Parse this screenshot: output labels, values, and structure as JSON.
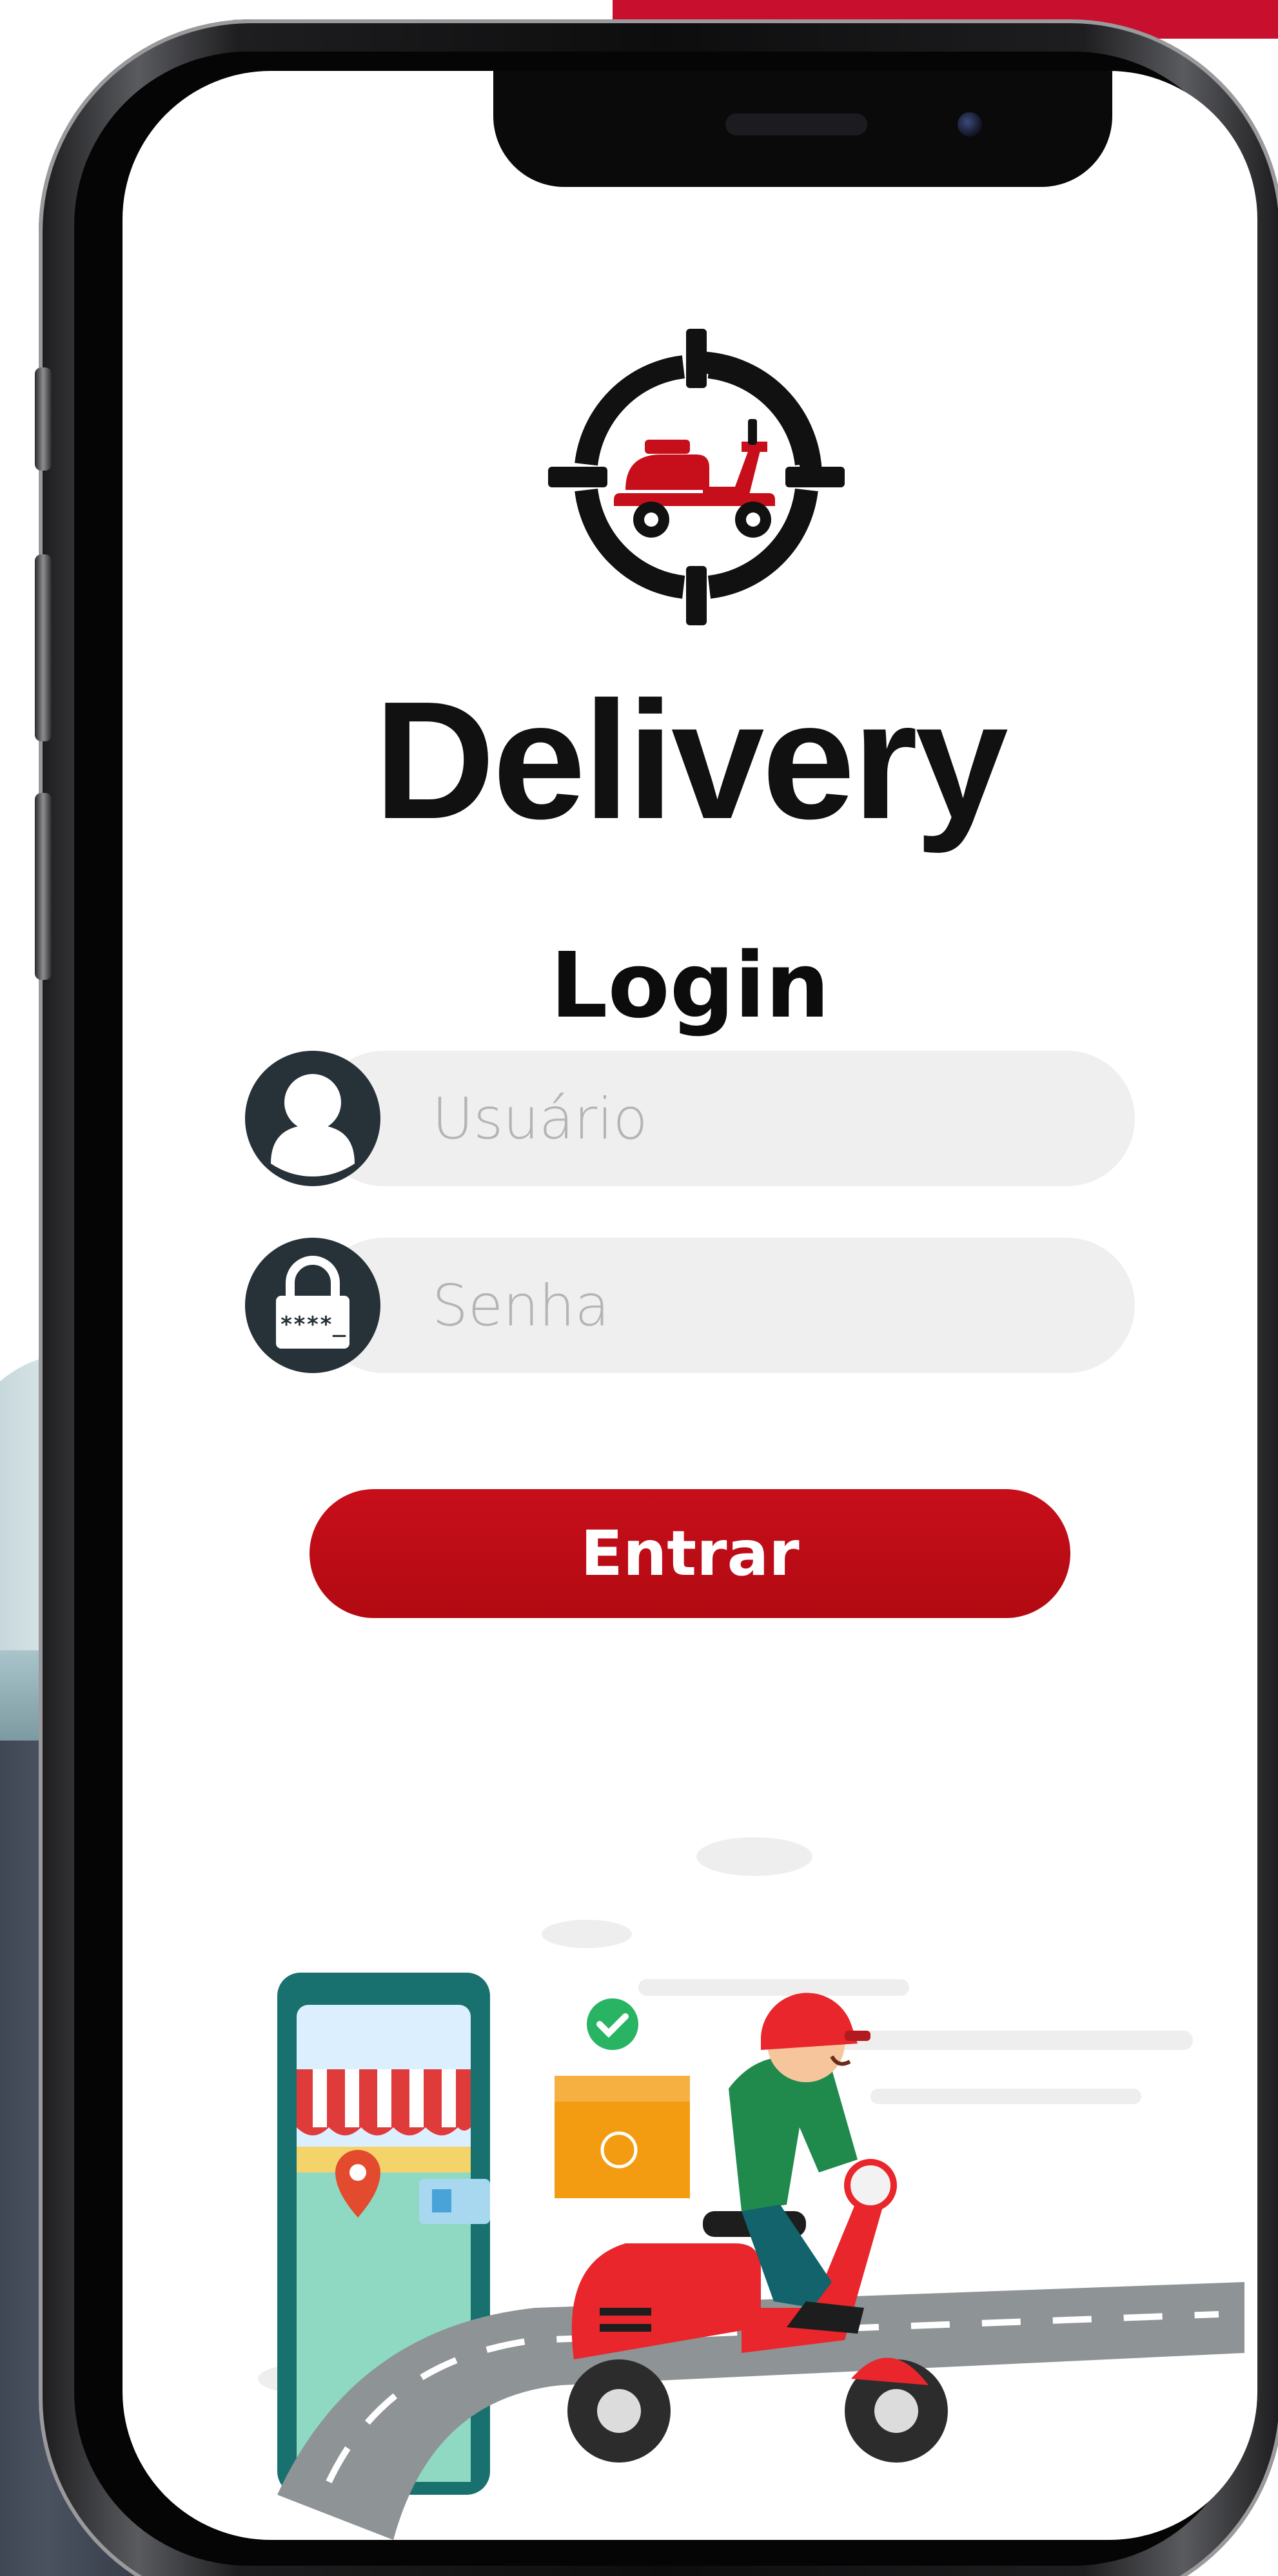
{
  "brand": {
    "name": "Delivery",
    "primary_color": "#c70f1b",
    "dark_color": "#111111"
  },
  "login": {
    "title": "Login",
    "username": {
      "placeholder": "Usuário",
      "icon": "user-icon"
    },
    "password": {
      "placeholder": "Senha",
      "icon": "lock-icon",
      "lock_text": "****_"
    },
    "submit_label": "Entrar"
  },
  "illustration": {
    "subject": "delivery-scooter-illustration"
  }
}
